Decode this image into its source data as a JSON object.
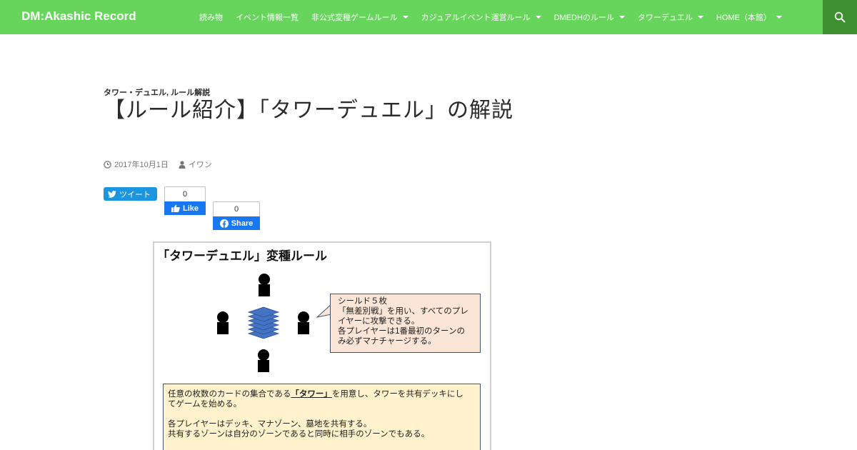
{
  "site": {
    "title": "DM:Akashic Record"
  },
  "nav": {
    "items": [
      {
        "label": "読み物",
        "has_submenu": false
      },
      {
        "label": "イベント情報一覧",
        "has_submenu": false
      },
      {
        "label": "非公式変種ゲームルール",
        "has_submenu": true
      },
      {
        "label": "カジュアルイベント運営ルール",
        "has_submenu": true
      },
      {
        "label": "DMEDHのルール",
        "has_submenu": true
      },
      {
        "label": "タワーデュエル",
        "has_submenu": true
      },
      {
        "label": "HOME（本館）",
        "has_submenu": true
      }
    ],
    "search_icon": "search-icon"
  },
  "post": {
    "categories": "タワー・デュエル, ルール解説",
    "title": "【ルール紹介】「タワーデュエル」の解説",
    "date": "2017年10月1日",
    "author": "イワン"
  },
  "social": {
    "tweet_label": "ツイート",
    "like_count": "0",
    "like_label": "Like",
    "share_count": "0",
    "share_label": "Share"
  },
  "figure": {
    "title": "「タワーデュエル」変種ルール",
    "bubble_lines": [
      "シールド５枚",
      "「無差別戦」を用い、すべてのプレ",
      "イヤーに攻撃できる。",
      "各プレイヤーは1番最初のターンの",
      "み必ずマナチャージする。"
    ],
    "rule_line1_before": "任意の枚数のカードの集合である",
    "rule_tower": "「タワー」",
    "rule_line1_after": "を用意し、タワーを共有デッキにし",
    "rule_line2": "てゲームを始める。",
    "rule_line3": "各プレイヤーはデッキ、マナゾーン、墓地を共有する。",
    "rule_line4": "共有するゾーンは自分のゾーンであると同時に相手のゾーンでもある。"
  },
  "colors": {
    "header_bg": "#67d55c",
    "search_bg": "#3d8f2f",
    "tweet_blue": "#1b95e0",
    "facebook_blue": "#1877f2",
    "bubble_bg": "#fbe5d6",
    "rule_box_bg": "#fff2cc",
    "deck_blue": "#4472c4"
  }
}
